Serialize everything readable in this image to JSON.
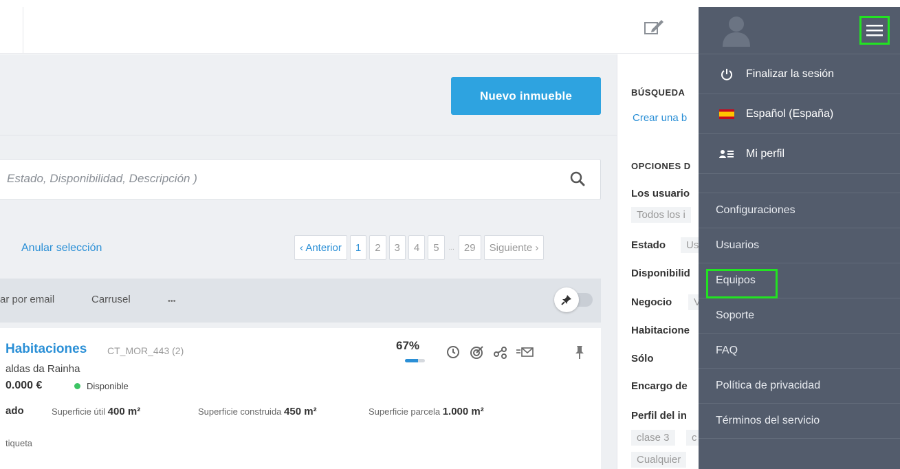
{
  "topbar": {
    "edit_icon": "edit-icon"
  },
  "header": {
    "new_property_button": "Nuevo inmueble"
  },
  "search": {
    "placeholder": "Estado, Disponibilidad, Descripción )"
  },
  "selection": {
    "clear_label": "Anular selección"
  },
  "pagination": {
    "prev": "‹ Anterior",
    "pages": [
      "1",
      "2",
      "3",
      "4",
      "5"
    ],
    "ellipsis": "...",
    "last": "29",
    "next": "Siguiente ›",
    "current": "1"
  },
  "actions": {
    "email": "ar por email",
    "carousel": "Carrusel",
    "more": "•••"
  },
  "property": {
    "title": "Habitaciones",
    "code": "CT_MOR_443 (2)",
    "location": "aldas da Rainha",
    "price": "0.000 €",
    "status": "Disponible",
    "state": "ado",
    "spec_useful_label": "Superficie útil",
    "spec_useful_value": "400 m²",
    "spec_built_label": "Superficie construida",
    "spec_built_value": "450 m²",
    "spec_plot_label": "Superficie parcela",
    "spec_plot_value": "1.000 m²",
    "tag": "tiqueta",
    "completeness": "67%",
    "completeness_fraction": 0.67,
    "status_color": "#3cc464"
  },
  "filters": {
    "search_heading": "BÚSQUEDA",
    "create_link": "Crear una b",
    "options_heading": "OPCIONES D",
    "users_label": "Los usuario",
    "users_value": "Todos los i",
    "state_label": "Estado",
    "state_value": "Us",
    "availability_label": "Disponibilid",
    "business_label": "Negocio",
    "business_value": "V",
    "rooms_label": "Habitacione",
    "only_label": "Sólo",
    "assignment_label": "Encargo de",
    "profile_label": "Perfil del in",
    "profile_chip1": "clase 3",
    "profile_chip2": "c",
    "any_chip": "Cualquier"
  },
  "menu": {
    "logout": "Finalizar la sesión",
    "language": "Español (España)",
    "profile": "Mi perfil",
    "links": [
      "Configuraciones",
      "Usuarios",
      "Equipos",
      "Soporte",
      "FAQ",
      "Política de privacidad",
      "Términos del servicio"
    ]
  },
  "colors": {
    "accent": "#2ea3e0",
    "menu_bg": "#535c6c",
    "highlight": "#22e322"
  }
}
